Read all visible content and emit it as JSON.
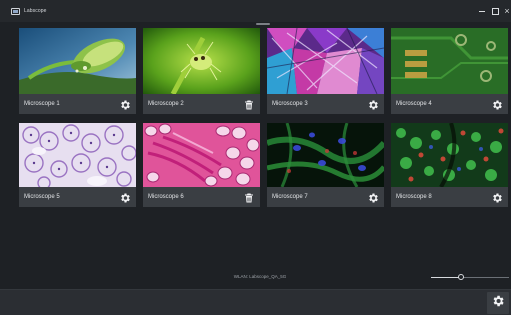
{
  "window": {
    "title": "Labscope",
    "close_glyph": "×"
  },
  "cards": [
    {
      "label": "Microscope 1",
      "action_icon": "gear-icon"
    },
    {
      "label": "Microscope 2",
      "action_icon": "trash-icon"
    },
    {
      "label": "Microscope 3",
      "action_icon": "gear-icon"
    },
    {
      "label": "Microscope 4",
      "action_icon": "gear-icon"
    },
    {
      "label": "Microscope 5",
      "action_icon": "gear-icon"
    },
    {
      "label": "Microscope 6",
      "action_icon": "trash-icon"
    },
    {
      "label": "Microscope 7",
      "action_icon": "gear-icon"
    },
    {
      "label": "Microscope 8",
      "action_icon": "gear-icon"
    }
  ],
  "status": {
    "label": "WLAN: Labscope_QA_5G"
  },
  "zoom": {
    "value_fraction": 0.38
  },
  "colors": {
    "background": "#1e2125",
    "caption_bar": "#3a3e43",
    "accent_light": "#d7dade"
  }
}
